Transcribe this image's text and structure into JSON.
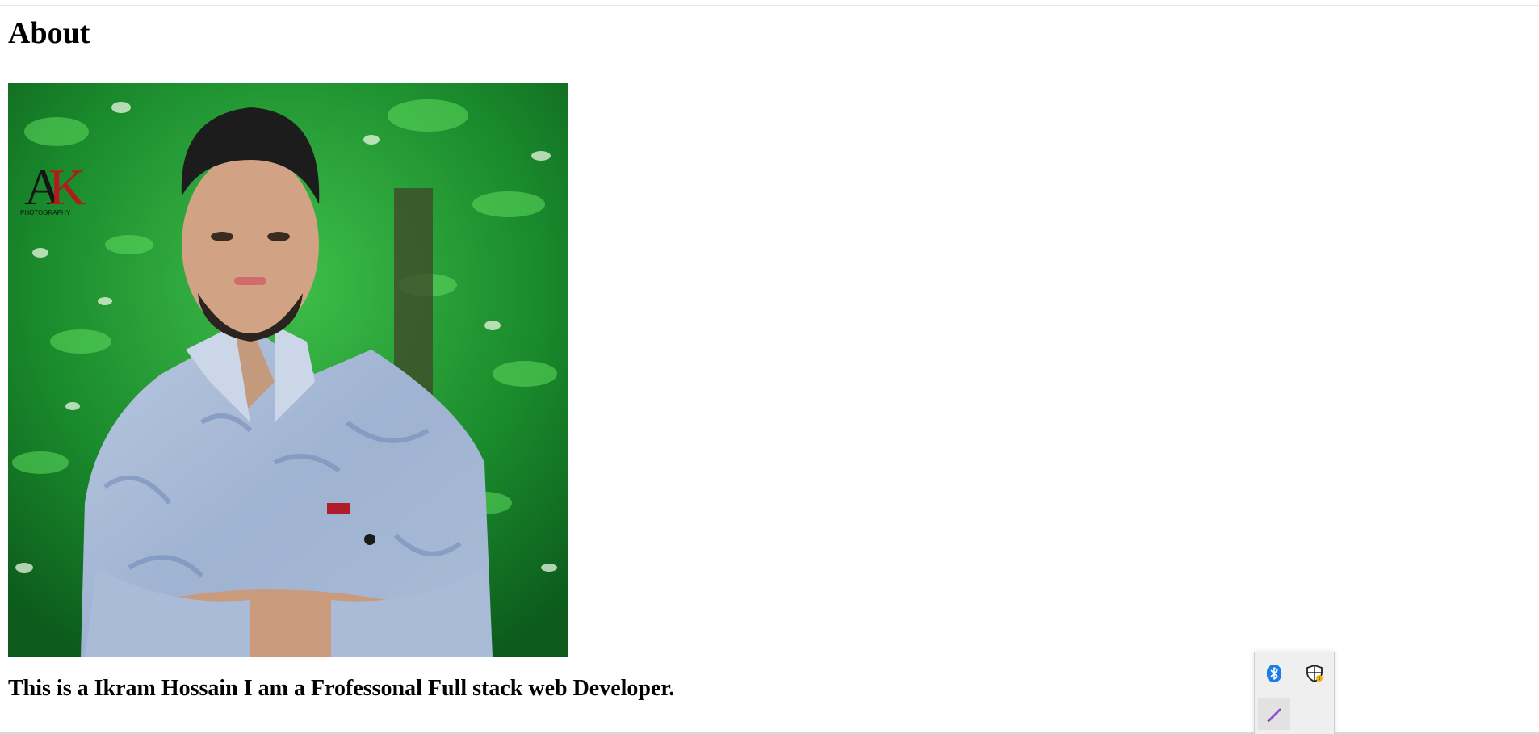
{
  "page": {
    "title": "About",
    "bio": "This is a Ikram Hossain I am a Frofessonal Full stack web Developer."
  },
  "photo": {
    "watermark_letters": "AK",
    "watermark_text": "PHOTOGRAPHY"
  },
  "tray": {
    "icons": [
      {
        "name": "bluetooth-icon",
        "color": "#1a7ce6"
      },
      {
        "name": "security-shield-icon",
        "color": "#222222"
      },
      {
        "name": "pen-icon",
        "color": "#8a4fd1"
      }
    ]
  },
  "colors": {
    "background": "#ffffff",
    "text": "#000000",
    "rule": "#8c8c8c"
  }
}
